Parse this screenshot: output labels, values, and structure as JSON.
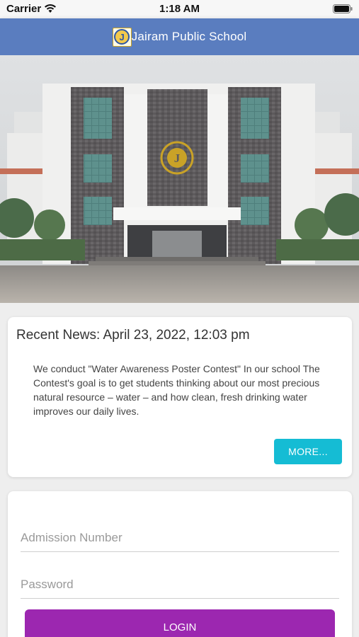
{
  "status_bar": {
    "carrier": "Carrier",
    "time": "1:18 AM",
    "wifi_icon": "wifi-icon",
    "battery_icon": "battery-icon"
  },
  "app_bar": {
    "logo_icon": "school-logo",
    "logo_letter": "J",
    "title": "Jairam Public School",
    "color": "#5a7dbf"
  },
  "hero": {
    "image": "school-building-photo"
  },
  "news": {
    "heading": "Recent News: April 23, 2022, 12:03 pm",
    "body": "We conduct \"Water Awareness Poster Contest\" In our school The Contest's goal is to get students thinking about our most precious natural resource – water – and how clean, fresh drinking water improves our daily lives.",
    "more_label": "MORE...",
    "more_color": "#15bcd4"
  },
  "login": {
    "admission_placeholder": "Admission Number",
    "admission_value": "",
    "password_placeholder": "Password",
    "password_value": "",
    "login_label": "LOGIN",
    "login_color": "#9c27b0"
  }
}
